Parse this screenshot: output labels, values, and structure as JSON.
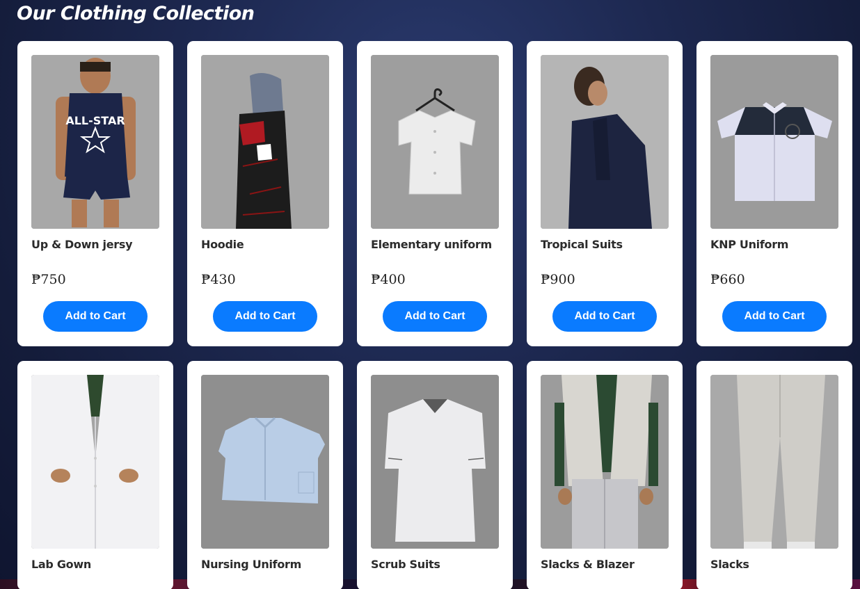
{
  "page": {
    "heading": "Our Clothing Collection"
  },
  "products": [
    {
      "name": "Up & Down jersy",
      "price": "₱750",
      "button": "Add to Cart",
      "image": "jersey-photo"
    },
    {
      "name": "Hoodie",
      "price": "₱430",
      "button": "Add to Cart",
      "image": "hoodie-photo"
    },
    {
      "name": "Elementary uniform",
      "price": "₱400",
      "button": "Add to Cart",
      "image": "blouse-on-hanger-photo"
    },
    {
      "name": "Tropical Suits",
      "price": "₱900",
      "button": "Add to Cart",
      "image": "navy-suit-photo"
    },
    {
      "name": "KNP Uniform",
      "price": "₱660",
      "button": "Add to Cart",
      "image": "two-tone-shirt-photo"
    },
    {
      "name": "Lab Gown",
      "image": "lab-coat-photo"
    },
    {
      "name": "Nursing Uniform",
      "image": "blue-nursing-top-photo"
    },
    {
      "name": "Scrub Suits",
      "image": "white-scrub-top-photo"
    },
    {
      "name": "Slacks & Blazer",
      "image": "vest-and-slacks-photo"
    },
    {
      "name": "Slacks",
      "image": "grey-slacks-photo"
    }
  ],
  "colors": {
    "accent": "#0a7bff",
    "card": "#ffffff",
    "background": "#1d2850"
  }
}
